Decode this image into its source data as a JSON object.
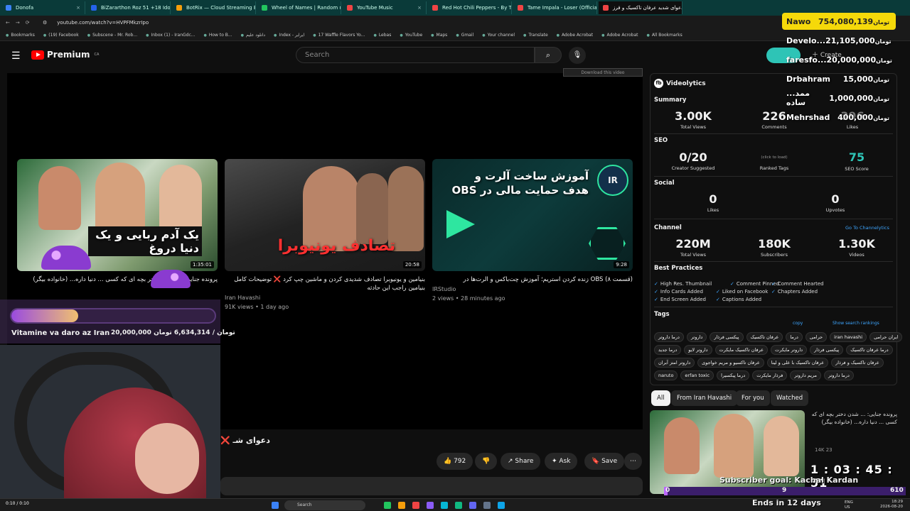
{
  "tabs": [
    {
      "title": "Donofa",
      "color": "#3b82f6"
    },
    {
      "title": "BiZararthon Roz 51 +18 Idonati...",
      "color": "#2563eb"
    },
    {
      "title": "BotRix — Cloud Streaming Bot",
      "color": "#f59e0b"
    },
    {
      "title": "Wheel of Names | Random nam...",
      "color": "#22c55e"
    },
    {
      "title": "YouTube Music",
      "color": "#ef4444"
    },
    {
      "title": "Red Hot Chili Peppers - By The...",
      "color": "#ef4444"
    },
    {
      "title": "Tame Impala - Loser (Official V...",
      "color": "#ef4444"
    },
    {
      "title": "دعوای شدید عرفان تاکسیک و فرز...",
      "color": "#ef4444",
      "active": true
    }
  ],
  "address": {
    "url": "youtube.com/watch?v=HVPFMkzrIpo"
  },
  "bookmarks": [
    "Bookmarks",
    "(19) Facebook",
    "Subscene - Mr. Rob...",
    "Inbox (1) - IranGdc...",
    "How to B...",
    "دانلود علیم",
    "Index - ایرایر",
    "17 Waffle Flavors Yo...",
    "Lebas",
    "YouTube",
    "Maps",
    "Gmail",
    "Your channel",
    "Translate",
    "Adobe Acrobat",
    "Adobe Acrobat",
    "All Bookmarks"
  ],
  "header": {
    "logo_text": "Premium",
    "logo_region": "CA",
    "search_placeholder": "Search",
    "create_label": "Create"
  },
  "player": {
    "download_label": "Download this video"
  },
  "videos": [
    {
      "title": "پرونده جنایی: ... شدن دختر بچه ای که کسی ... دنیا داره... (خانواده بیگر)",
      "duration": "1:35:01",
      "thumb_text": "یک آدم ربایی و یک دنیا دروغ",
      "channel": "",
      "meta": ""
    },
    {
      "title": "بنیامین و یونیوبرا تصادف شدیدی کردن و ماشین چپ کرد ❌ توضیحات کامل بنیامین راجب این حادثه",
      "duration": "20:58",
      "thumb_text": "تصادف یونیوبرا",
      "channel": "Iran Havashi",
      "meta": "91K views • 1 day ago"
    },
    {
      "title": "(قسمت ۸) OBS زنده کردن استریم؛ آموزش چت‌باکس و الرت‌ها در",
      "duration": "9:28",
      "thumb_text": "آموزش ساخت آلرت و هدف حمایت مالی در OBS",
      "channel": "IRStudio",
      "meta": "2 views • 28 minutes ago"
    }
  ],
  "video_title": "دعوای شـ ❌",
  "actions": {
    "likes": "792",
    "share": "Share",
    "ask": "Ask",
    "save": "Save"
  },
  "videolytics": {
    "brand": "Videolytics",
    "summary": {
      "label": "Summary",
      "views": "3.00K",
      "views_label": "Total Views",
      "comments": "226",
      "comments_label": "Comments",
      "likes": "396",
      "likes_label": "Likes"
    },
    "seo": {
      "label": "SEO",
      "creator": "0/20",
      "creator_label": "Creator Suggested",
      "ranked_hint": "(click to load)",
      "ranked_label": "Ranked Tags",
      "score": "75",
      "score_label": "SEO Score"
    },
    "social": {
      "label": "Social",
      "likes": "0",
      "likes_label": "Likes",
      "upvotes": "0",
      "upvotes_label": "Upvotes"
    },
    "channel": {
      "label": "Channel",
      "link": "Go To Channelytics",
      "views": "220M",
      "views_label": "Total Views",
      "subs": "180K",
      "subs_label": "Subscribers",
      "videos": "1.30K",
      "videos_label": "Videos"
    },
    "best_practices": {
      "label": "Best Practices",
      "items": [
        "High Res. Thumbnail",
        "Comment Pinned",
        "Comment Hearted",
        "Info Cards Added",
        "Liked on Facebook",
        "Chapters Added",
        "End Screen Added",
        "Captions Added"
      ]
    },
    "tags": {
      "label": "Tags",
      "copy": "copy",
      "show_rankings": "Show search rankings",
      "rows": [
        [
          "درما داروتر",
          "داروتر",
          "پیکسی فرذار",
          "عرفان تاکسیک",
          "درما",
          "حرامی",
          "iran havashi",
          "ایران حرامی"
        ],
        [
          "درما جدید",
          "داروتر لایو",
          "عرفان تاکسیک مایکرت",
          "داروتر مایکرت",
          "پیکسی فرذار",
          "درما عرفان تاکسیک"
        ],
        [
          "داروتر امتز آبران",
          "عرفان تاکسیو و مریم خواجوی",
          "عرفان تاکسیک با علی و لینا",
          "عرفان تاکسیک و فرذار"
        ],
        [
          "naruto",
          "erfan toxic",
          "درما پیکسیرا",
          "فرذار مایکرت",
          "مریم داروتر",
          "درما داروتر"
        ]
      ]
    }
  },
  "chips": [
    "All",
    "From Iran Havashi",
    "For you",
    "Watched"
  ],
  "side_video": {
    "title": "پرونده جنایی: ... شدن دختر بچه ای که کسی ... دنیا داره... (خانواده بیگر)",
    "meta": "14K  23"
  },
  "donations": [
    {
      "name": "Nawo",
      "amount": "754,080,139"
    },
    {
      "name": "Develo...",
      "amount": "21,105,000"
    },
    {
      "name": "faresfo...",
      "amount": "20,000,000"
    },
    {
      "name": "Drbahram",
      "amount": "15,000"
    },
    {
      "name": "...ممد ساده",
      "amount": "1,000,000"
    },
    {
      "name": "Mehrshad",
      "amount": "400,000"
    }
  ],
  "currency": "تومان",
  "goal": {
    "name": "Vitamine va daro az Iran",
    "raised": "6,634,314",
    "target": "20,000,000",
    "fraction": 0.33
  },
  "sub_goal": {
    "timer": "1 : 03 : 45 : 51",
    "label": "Subscriber goal: Kachal Kardan",
    "start": "0",
    "current": "9",
    "target": "610",
    "ends": "Ends in 12 days"
  },
  "taskbar": {
    "search": "Search",
    "lang": "ENG US",
    "time": "18:29",
    "date": "2026-08-20"
  },
  "timecode": "0:10 / 0:10",
  "colors": {
    "accent": "#ff0000",
    "donation_top": "#f5d90a",
    "goal_fill": "#9a4be0",
    "sub_bar": "#bb66ff",
    "link": "#3ea6ff",
    "seo_score": "#2ec4b6"
  }
}
